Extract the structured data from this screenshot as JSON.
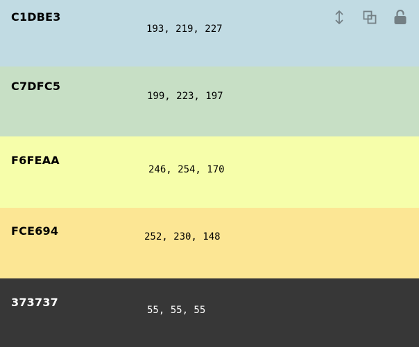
{
  "swatches": [
    {
      "hex": "C1DBE3",
      "rgb": "193, 219, 227",
      "bg": "#C1DBE3",
      "fg": "#000000"
    },
    {
      "hex": "C7DFC5",
      "rgb": "199, 223, 197",
      "bg": "#C7DFC5",
      "fg": "#000000"
    },
    {
      "hex": "F6FEAA",
      "rgb": "246, 254, 170",
      "bg": "#F6FEAA",
      "fg": "#000000"
    },
    {
      "hex": "FCE694",
      "rgb": "252, 230, 148",
      "bg": "#FCE694",
      "fg": "#000000"
    },
    {
      "hex": "373737",
      "rgb": "55, 55, 55",
      "bg": "#373737",
      "fg": "#FFFFFF"
    }
  ],
  "toolbar": {
    "icons": [
      "drag-handle-icon",
      "copy-icon",
      "unlock-icon"
    ],
    "icon_color": "#737F84"
  }
}
